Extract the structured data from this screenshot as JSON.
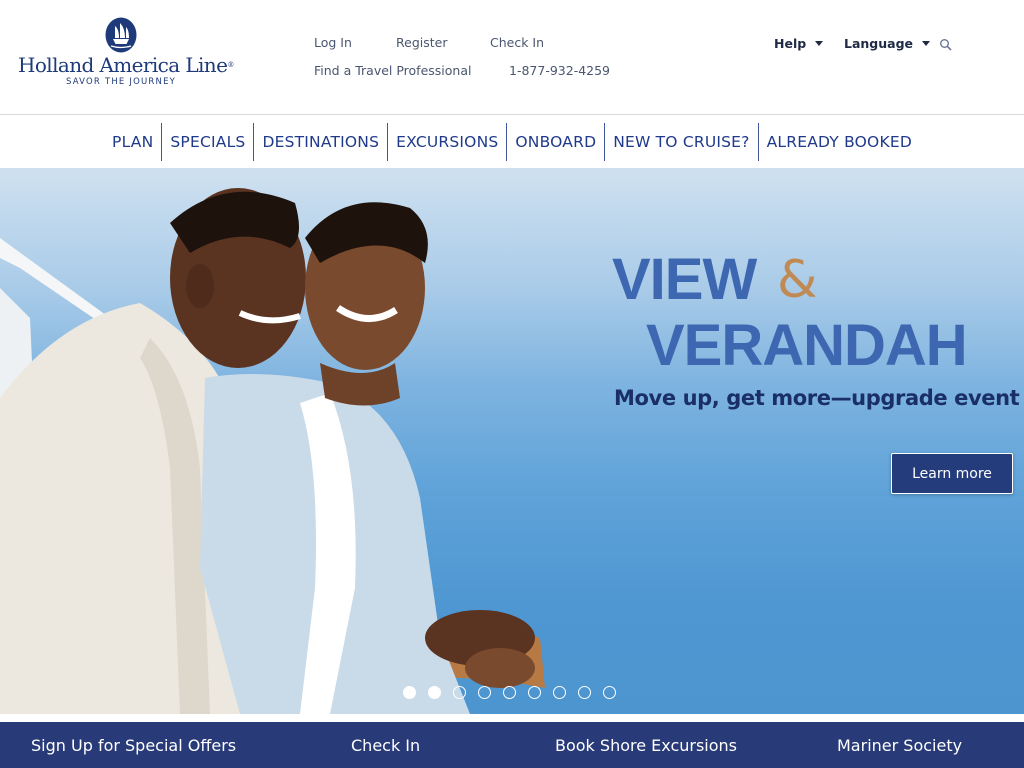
{
  "brand": {
    "name": "Holland America Line",
    "registered": "®",
    "tagline": "SAVOR THE JOURNEY",
    "color": "#1f3a7a"
  },
  "utility_nav": {
    "login": "Log In",
    "register": "Register",
    "check_in": "Check In",
    "find_travel_pro": "Find a Travel Professional",
    "phone": "1-877-932-4259",
    "help": "Help",
    "language": "Language",
    "search_icon": "search-icon"
  },
  "main_nav": {
    "items": [
      {
        "label": "PLAN"
      },
      {
        "label": "SPECIALS"
      },
      {
        "label": "DESTINATIONS"
      },
      {
        "label": "EXCURSIONS"
      },
      {
        "label": "ONBOARD"
      },
      {
        "label": "NEW TO CRUISE?"
      },
      {
        "label": "ALREADY BOOKED"
      }
    ],
    "color": "#1f3a8a"
  },
  "hero": {
    "headline_line1": "VIEW",
    "ampersand": "&",
    "headline_line2": "VERANDAH",
    "subheadline": "Move up, get more—upgrade event",
    "cta": "Learn more",
    "headline_color": "#3d67b0",
    "ampersand_color": "#c08a55",
    "cta_color": "#243c7c",
    "carousel": {
      "total_slides": 9,
      "active_slides": [
        1,
        2
      ]
    }
  },
  "footer_bar": {
    "items": [
      {
        "label": "Sign Up for Special Offers"
      },
      {
        "label": "Check In"
      },
      {
        "label": "Book Shore Excursions"
      },
      {
        "label": "Mariner Society"
      }
    ],
    "color": "#283a77"
  }
}
